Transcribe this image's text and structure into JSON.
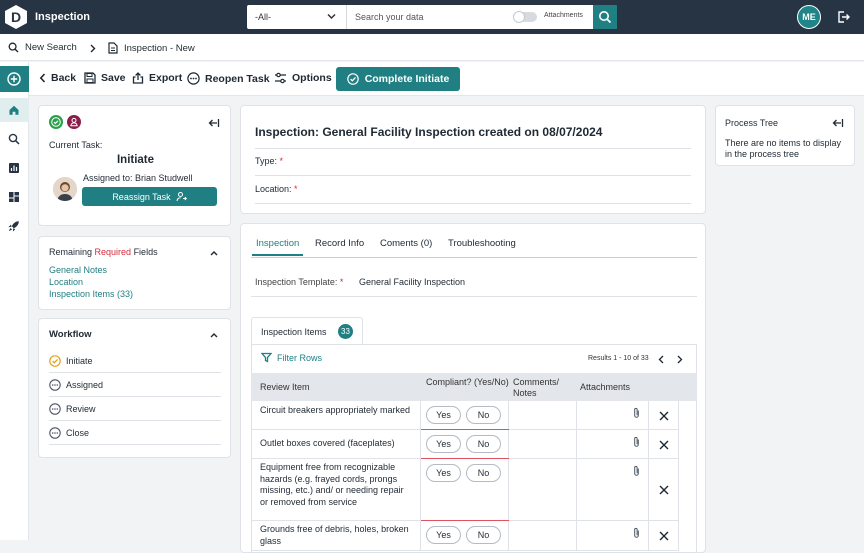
{
  "topbar": {
    "logo_letter": "D",
    "app_title": "Inspection",
    "scope_value": "-All-",
    "search_placeholder": "Search your data",
    "attachments_label": "Attachments",
    "user_initials": "ME"
  },
  "breadcrumb": {
    "new_search": "New Search",
    "current": "Inspection - New"
  },
  "toolbar": {
    "back": "Back",
    "save": "Save",
    "export": "Export",
    "reopen_task": "Reopen Task",
    "options": "Options",
    "complete": "Complete Initiate"
  },
  "task_panel": {
    "current_task_label": "Current Task:",
    "current_task": "Initiate",
    "assigned_to": "Assigned to: Brian Studwell",
    "reassign_button": "Reassign Task"
  },
  "remaining": {
    "prefix": "Remaining ",
    "required": "Required",
    "suffix": " Fields",
    "items": [
      "General Notes",
      "Location",
      "Inspection Items (33)"
    ]
  },
  "workflow": {
    "title": "Workflow",
    "steps": [
      "Initiate",
      "Assigned",
      "Review",
      "Close"
    ]
  },
  "header_card": {
    "title": "Inspection: General Facility Inspection created on 08/07/2024",
    "type_label": "Type:",
    "location_label": "Location:",
    "required_mark": "*"
  },
  "tabs": [
    "Inspection",
    "Record Info",
    "Coments (0)",
    "Troubleshooting"
  ],
  "inspection": {
    "template_label": "Inspection Template:",
    "template_value": "General Facility Inspection",
    "items_tab_label": "Inspection Items",
    "items_count": "33",
    "filter_label": "Filter Rows",
    "results": "Results 1 - 10 of 33",
    "columns": [
      "Review Item",
      "Compliant? (Yes/No)",
      "Comments/ Notes",
      "Attachments"
    ],
    "yes_label": "Yes",
    "no_label": "No",
    "rows": [
      "Circuit breakers appropriately marked",
      "Outlet boxes covered (faceplates)",
      "Equipment free from recognizable hazards (e.g. frayed cords, prongs missing, etc.) and/ or needing repair or removed from service",
      "Grounds free of debris, holes, broken glass"
    ]
  },
  "process_tree": {
    "title": "Process Tree",
    "empty_message": "There are no items to display in the process tree"
  },
  "colors": {
    "topbar": "#263444",
    "accent": "#1f7f82",
    "required": "#d12c3c",
    "task_green": "#2aa04a",
    "task_maroon": "#8b1d4a"
  }
}
